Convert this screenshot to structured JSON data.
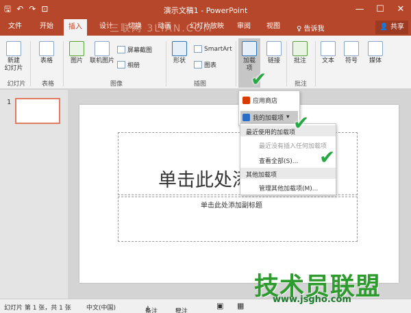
{
  "titlebar": {
    "title": "演示文稿1 - PowerPoint",
    "qat": [
      "save-icon",
      "undo-icon",
      "redo-icon",
      "slideshow-icon"
    ],
    "window_buttons": [
      "—",
      "☐",
      "✕"
    ]
  },
  "tabs": [
    "文件",
    "开始",
    "插入",
    "设计",
    "切换",
    "动画",
    "幻灯片放映",
    "审阅",
    "视图"
  ],
  "active_tab": "插入",
  "tell_me": "告诉我",
  "share": "共享",
  "watermark_top": "三联网 3LIAN.COM",
  "ribbon": {
    "new_slide": "新建\n幻灯片",
    "table": "表格",
    "picture": "图片",
    "online_picture": "联机图片",
    "screenshot": "屏幕截图",
    "album": "相册",
    "shapes": "形状",
    "smartart": "SmartArt",
    "chart": "图表",
    "addins": "加载\n项",
    "links": "链接",
    "comment": "批注",
    "text": "文本",
    "symbols": "符号",
    "media": "媒体",
    "groups": [
      "幻灯片",
      "表格",
      "图像",
      "插图",
      "批注"
    ]
  },
  "thumbnail_number": "1",
  "slide": {
    "title_placeholder": "单击此处添",
    "subtitle_placeholder": "单击此处添加副标题"
  },
  "menu1": {
    "store": "应用商店",
    "my_addins": "我的加载项"
  },
  "menu2": {
    "recent_header": "最近使用的加载项",
    "recent_empty": "最近没有插入任何加载项",
    "view_all": "查看全部(S)...",
    "other_header": "其他加载项",
    "manage": "管理其他加载项(M)..."
  },
  "status": {
    "slide_info": "幻灯片 第 1 张，共 1 张",
    "language": "中文(中国)",
    "notes": "备注",
    "comments": "批注"
  },
  "watermark": {
    "text": "技术员联盟",
    "url": "www.jsgho.com"
  }
}
